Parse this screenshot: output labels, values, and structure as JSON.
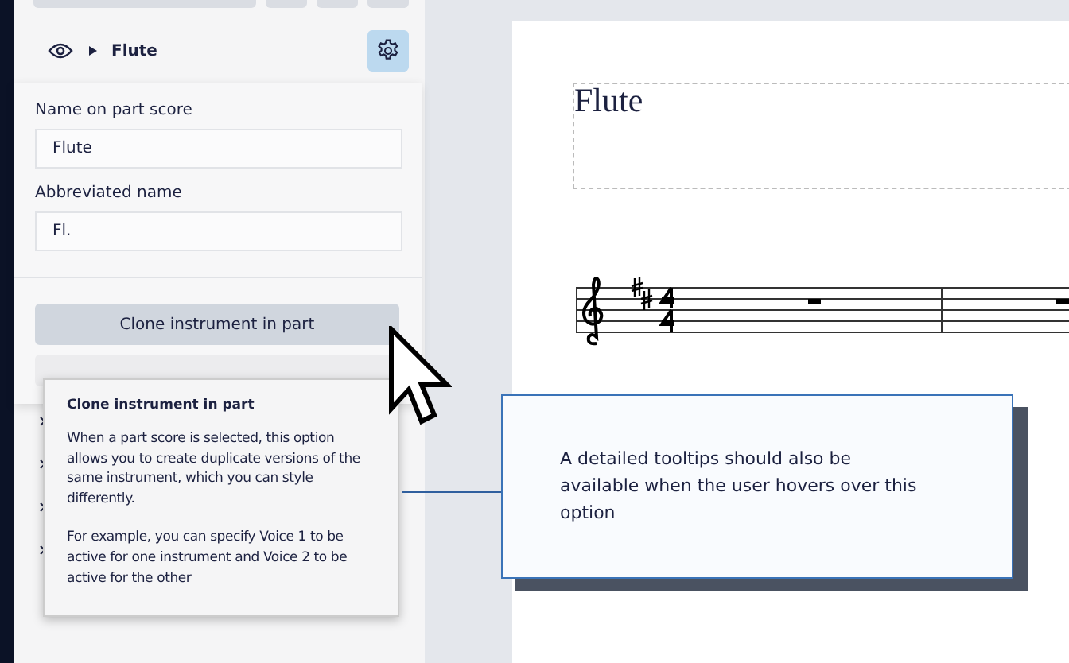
{
  "instrument": {
    "name": "Flute",
    "settings_active": true
  },
  "settings_popover": {
    "fields": [
      {
        "label": "Name on part score",
        "value": "Flute"
      },
      {
        "label": "Abbreviated name",
        "value": "Fl."
      }
    ],
    "button": "Clone instrument in part"
  },
  "tooltip": {
    "title": "Clone instrument in part",
    "paragraphs": [
      "When a part score is selected, this option allows you to create duplicate versions of the same instrument, which you can style differently.",
      "For example, you can specify Voice 1 to be active for one instrument and Voice 2 to be active for the other"
    ]
  },
  "annotation": {
    "text": "A detailed tooltips should also be available when the user hovers over this option"
  },
  "score": {
    "title": "Flute"
  }
}
